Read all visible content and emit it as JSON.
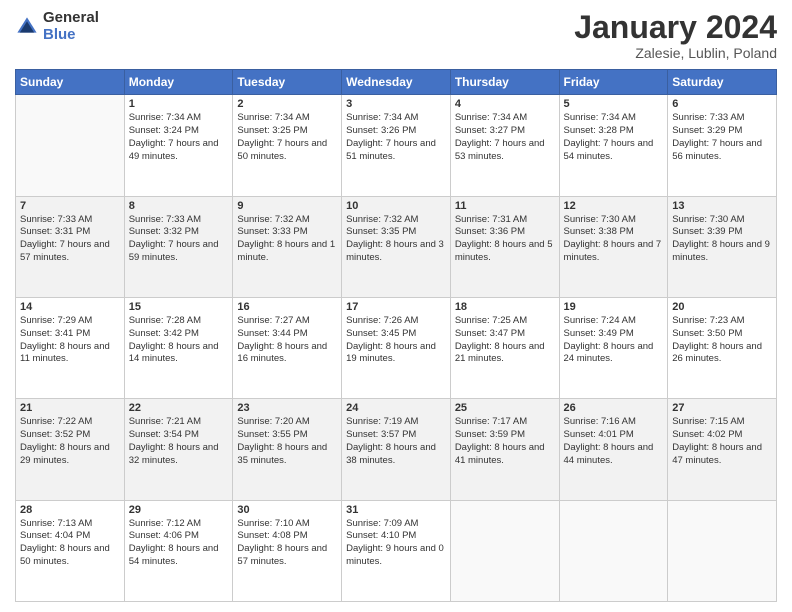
{
  "header": {
    "logo_line1": "General",
    "logo_line2": "Blue",
    "month": "January 2024",
    "location": "Zalesie, Lublin, Poland"
  },
  "days_of_week": [
    "Sunday",
    "Monday",
    "Tuesday",
    "Wednesday",
    "Thursday",
    "Friday",
    "Saturday"
  ],
  "weeks": [
    [
      {
        "day": null
      },
      {
        "day": 1,
        "sunrise": "Sunrise: 7:34 AM",
        "sunset": "Sunset: 3:24 PM",
        "daylight": "Daylight: 7 hours and 49 minutes."
      },
      {
        "day": 2,
        "sunrise": "Sunrise: 7:34 AM",
        "sunset": "Sunset: 3:25 PM",
        "daylight": "Daylight: 7 hours and 50 minutes."
      },
      {
        "day": 3,
        "sunrise": "Sunrise: 7:34 AM",
        "sunset": "Sunset: 3:26 PM",
        "daylight": "Daylight: 7 hours and 51 minutes."
      },
      {
        "day": 4,
        "sunrise": "Sunrise: 7:34 AM",
        "sunset": "Sunset: 3:27 PM",
        "daylight": "Daylight: 7 hours and 53 minutes."
      },
      {
        "day": 5,
        "sunrise": "Sunrise: 7:34 AM",
        "sunset": "Sunset: 3:28 PM",
        "daylight": "Daylight: 7 hours and 54 minutes."
      },
      {
        "day": 6,
        "sunrise": "Sunrise: 7:33 AM",
        "sunset": "Sunset: 3:29 PM",
        "daylight": "Daylight: 7 hours and 56 minutes."
      }
    ],
    [
      {
        "day": 7,
        "sunrise": "Sunrise: 7:33 AM",
        "sunset": "Sunset: 3:31 PM",
        "daylight": "Daylight: 7 hours and 57 minutes."
      },
      {
        "day": 8,
        "sunrise": "Sunrise: 7:33 AM",
        "sunset": "Sunset: 3:32 PM",
        "daylight": "Daylight: 7 hours and 59 minutes."
      },
      {
        "day": 9,
        "sunrise": "Sunrise: 7:32 AM",
        "sunset": "Sunset: 3:33 PM",
        "daylight": "Daylight: 8 hours and 1 minute."
      },
      {
        "day": 10,
        "sunrise": "Sunrise: 7:32 AM",
        "sunset": "Sunset: 3:35 PM",
        "daylight": "Daylight: 8 hours and 3 minutes."
      },
      {
        "day": 11,
        "sunrise": "Sunrise: 7:31 AM",
        "sunset": "Sunset: 3:36 PM",
        "daylight": "Daylight: 8 hours and 5 minutes."
      },
      {
        "day": 12,
        "sunrise": "Sunrise: 7:30 AM",
        "sunset": "Sunset: 3:38 PM",
        "daylight": "Daylight: 8 hours and 7 minutes."
      },
      {
        "day": 13,
        "sunrise": "Sunrise: 7:30 AM",
        "sunset": "Sunset: 3:39 PM",
        "daylight": "Daylight: 8 hours and 9 minutes."
      }
    ],
    [
      {
        "day": 14,
        "sunrise": "Sunrise: 7:29 AM",
        "sunset": "Sunset: 3:41 PM",
        "daylight": "Daylight: 8 hours and 11 minutes."
      },
      {
        "day": 15,
        "sunrise": "Sunrise: 7:28 AM",
        "sunset": "Sunset: 3:42 PM",
        "daylight": "Daylight: 8 hours and 14 minutes."
      },
      {
        "day": 16,
        "sunrise": "Sunrise: 7:27 AM",
        "sunset": "Sunset: 3:44 PM",
        "daylight": "Daylight: 8 hours and 16 minutes."
      },
      {
        "day": 17,
        "sunrise": "Sunrise: 7:26 AM",
        "sunset": "Sunset: 3:45 PM",
        "daylight": "Daylight: 8 hours and 19 minutes."
      },
      {
        "day": 18,
        "sunrise": "Sunrise: 7:25 AM",
        "sunset": "Sunset: 3:47 PM",
        "daylight": "Daylight: 8 hours and 21 minutes."
      },
      {
        "day": 19,
        "sunrise": "Sunrise: 7:24 AM",
        "sunset": "Sunset: 3:49 PM",
        "daylight": "Daylight: 8 hours and 24 minutes."
      },
      {
        "day": 20,
        "sunrise": "Sunrise: 7:23 AM",
        "sunset": "Sunset: 3:50 PM",
        "daylight": "Daylight: 8 hours and 26 minutes."
      }
    ],
    [
      {
        "day": 21,
        "sunrise": "Sunrise: 7:22 AM",
        "sunset": "Sunset: 3:52 PM",
        "daylight": "Daylight: 8 hours and 29 minutes."
      },
      {
        "day": 22,
        "sunrise": "Sunrise: 7:21 AM",
        "sunset": "Sunset: 3:54 PM",
        "daylight": "Daylight: 8 hours and 32 minutes."
      },
      {
        "day": 23,
        "sunrise": "Sunrise: 7:20 AM",
        "sunset": "Sunset: 3:55 PM",
        "daylight": "Daylight: 8 hours and 35 minutes."
      },
      {
        "day": 24,
        "sunrise": "Sunrise: 7:19 AM",
        "sunset": "Sunset: 3:57 PM",
        "daylight": "Daylight: 8 hours and 38 minutes."
      },
      {
        "day": 25,
        "sunrise": "Sunrise: 7:17 AM",
        "sunset": "Sunset: 3:59 PM",
        "daylight": "Daylight: 8 hours and 41 minutes."
      },
      {
        "day": 26,
        "sunrise": "Sunrise: 7:16 AM",
        "sunset": "Sunset: 4:01 PM",
        "daylight": "Daylight: 8 hours and 44 minutes."
      },
      {
        "day": 27,
        "sunrise": "Sunrise: 7:15 AM",
        "sunset": "Sunset: 4:02 PM",
        "daylight": "Daylight: 8 hours and 47 minutes."
      }
    ],
    [
      {
        "day": 28,
        "sunrise": "Sunrise: 7:13 AM",
        "sunset": "Sunset: 4:04 PM",
        "daylight": "Daylight: 8 hours and 50 minutes."
      },
      {
        "day": 29,
        "sunrise": "Sunrise: 7:12 AM",
        "sunset": "Sunset: 4:06 PM",
        "daylight": "Daylight: 8 hours and 54 minutes."
      },
      {
        "day": 30,
        "sunrise": "Sunrise: 7:10 AM",
        "sunset": "Sunset: 4:08 PM",
        "daylight": "Daylight: 8 hours and 57 minutes."
      },
      {
        "day": 31,
        "sunrise": "Sunrise: 7:09 AM",
        "sunset": "Sunset: 4:10 PM",
        "daylight": "Daylight: 9 hours and 0 minutes."
      },
      {
        "day": null
      },
      {
        "day": null
      },
      {
        "day": null
      }
    ]
  ]
}
